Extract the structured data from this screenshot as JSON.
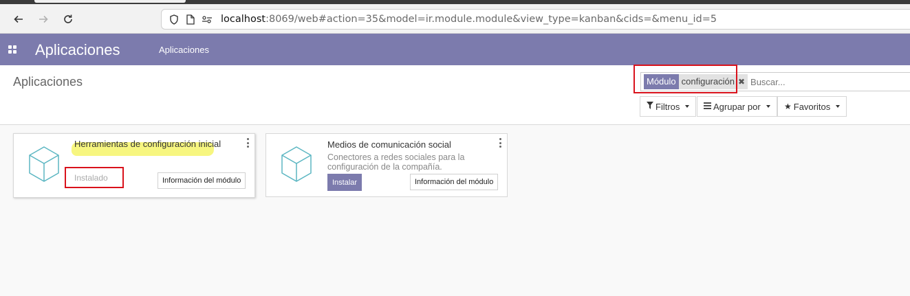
{
  "browser": {
    "back_icon": "arrow-left-icon",
    "forward_icon": "arrow-right-icon",
    "reload_icon": "reload-icon",
    "url_host": "localhost",
    "url_rest": ":8069/web#action=35&model=ir.module.module&view_type=kanban&cids=&menu_id=5"
  },
  "navbar": {
    "brand": "Aplicaciones",
    "menu_item": "Aplicaciones",
    "color": "#7c7bad"
  },
  "control_panel": {
    "breadcrumb": "Aplicaciones",
    "search": {
      "facet_label": "Módulo",
      "facet_value": "configuración",
      "placeholder": "Buscar..."
    },
    "buttons": {
      "filters": "Filtros",
      "group_by": "Agrupar por",
      "favorites": "Favoritos"
    }
  },
  "modules": [
    {
      "title": "Herramientas de configuración inicial",
      "status": "Instalado",
      "info_button": "Información del módulo"
    },
    {
      "title": "Medios de comunicación social",
      "description": "Conectores a redes sociales para la configuración de la compañía.",
      "install_button": "Instalar",
      "info_button": "Información del módulo"
    }
  ],
  "annotations": {
    "highlight_color": "#d9111b",
    "marker_color": "#f6f46a"
  }
}
